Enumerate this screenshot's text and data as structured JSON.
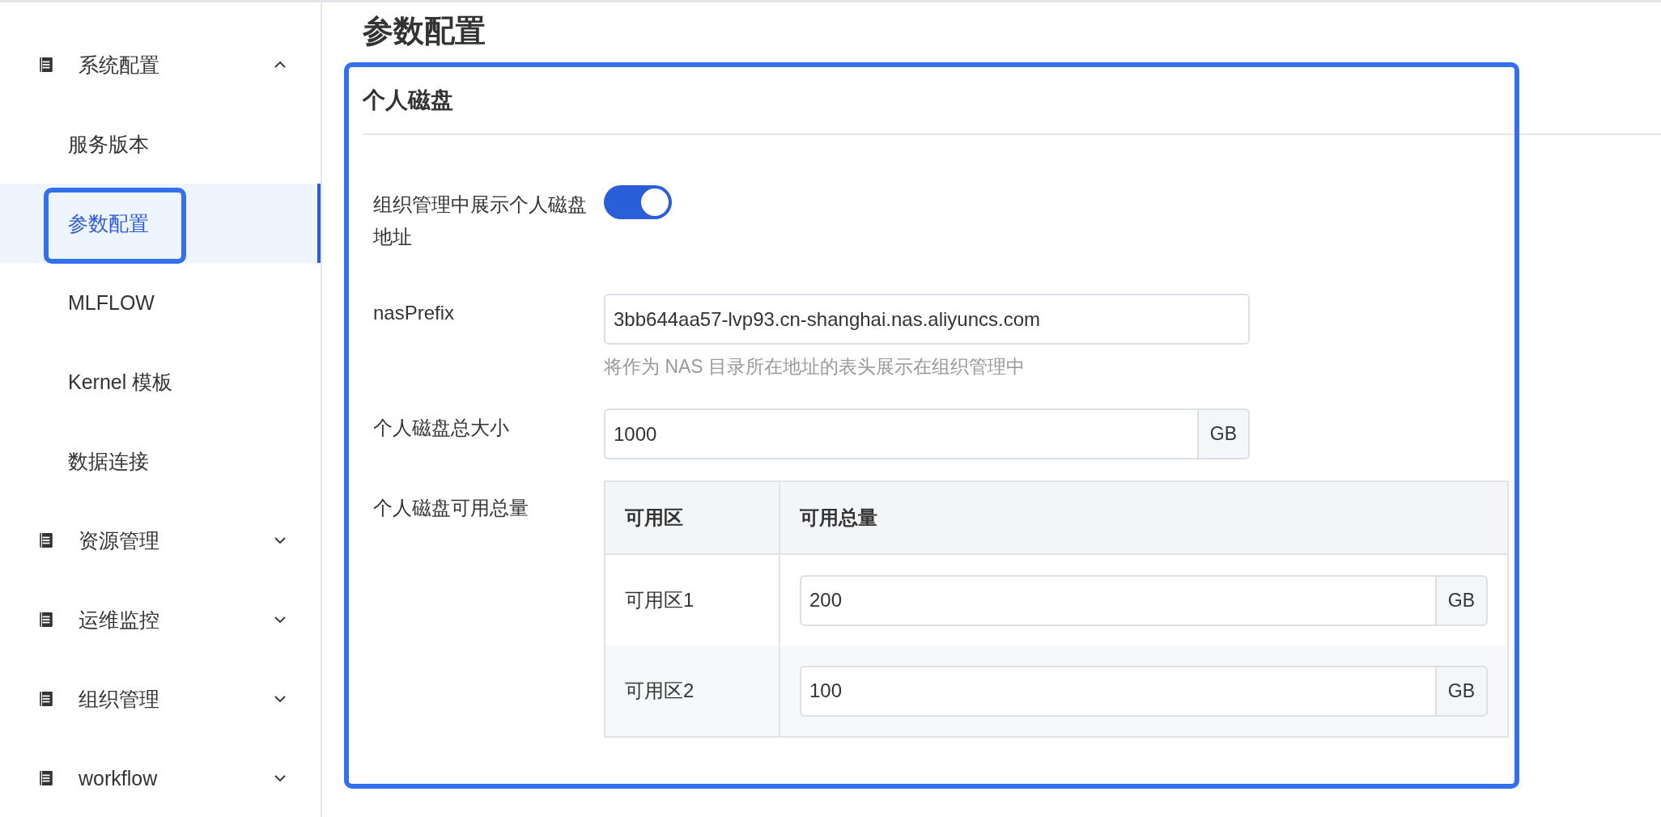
{
  "sidebar": {
    "groups": [
      {
        "label": "系统配置",
        "expanded": true,
        "children": [
          {
            "label": "服务版本",
            "selected": false
          },
          {
            "label": "参数配置",
            "selected": true
          },
          {
            "label": "MLFLOW",
            "selected": false
          },
          {
            "label": "Kernel 模板",
            "selected": false
          },
          {
            "label": "数据连接",
            "selected": false
          }
        ]
      },
      {
        "label": "资源管理",
        "expanded": false
      },
      {
        "label": "运维监控",
        "expanded": false
      },
      {
        "label": "组织管理",
        "expanded": false
      },
      {
        "label": "workflow",
        "expanded": false
      }
    ]
  },
  "page_title": "参数配置",
  "section": {
    "title": "个人磁盘",
    "fields": [
      {
        "kind": "switch",
        "label": "组织管理中展示个人磁盘地址",
        "on": true
      },
      {
        "kind": "text",
        "label": "nasPrefix",
        "value": "3bb644aa57-lvp93.cn-shanghai.nas.aliyuncs.com",
        "hint": "将作为 NAS 目录所在地址的表头展示在组织管理中"
      },
      {
        "kind": "unit",
        "label": "个人磁盘总大小",
        "value": "1000",
        "unit": "GB"
      },
      {
        "kind": "table",
        "label": "个人磁盘可用总量",
        "columns": [
          "可用区",
          "可用总量"
        ],
        "rows": [
          {
            "zone": "可用区1",
            "value": "200",
            "unit": "GB"
          },
          {
            "zone": "可用区2",
            "value": "100",
            "unit": "GB"
          }
        ]
      }
    ]
  }
}
